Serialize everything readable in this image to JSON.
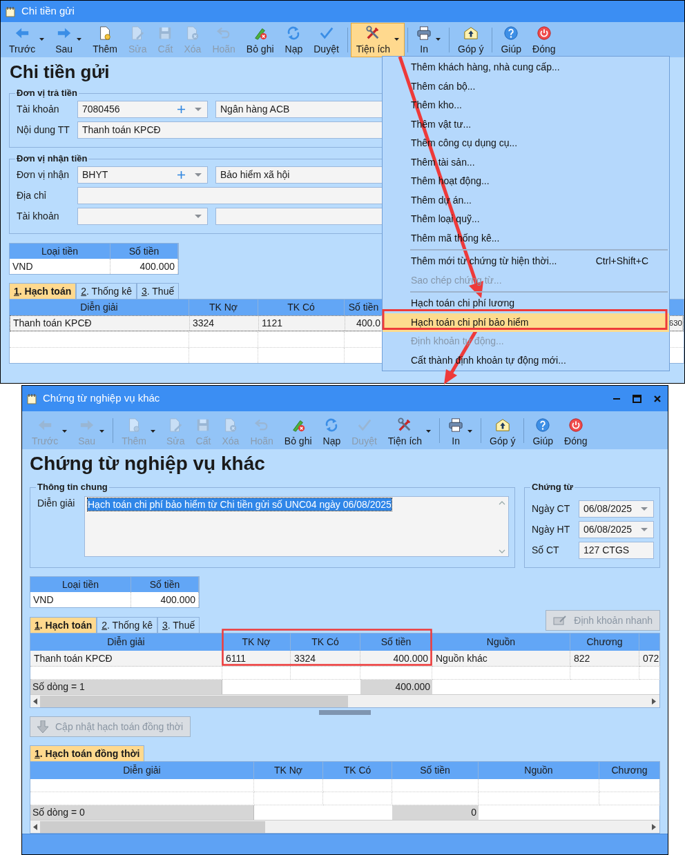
{
  "main_window": {
    "title": "Chi tiền gửi",
    "toolbar": [
      {
        "kind": "back",
        "label": "Trước",
        "disabled": false,
        "dropdown": true,
        "open": false
      },
      {
        "kind": "forward",
        "label": "Sau",
        "disabled": false,
        "dropdown": true,
        "open": false
      },
      {
        "kind": "new",
        "label": "Thêm",
        "disabled": false,
        "dropdown": false,
        "open": false
      },
      {
        "kind": "edit",
        "label": "Sửa",
        "disabled": true,
        "dropdown": false,
        "open": false
      },
      {
        "kind": "save",
        "label": "Cất",
        "disabled": true,
        "dropdown": false,
        "open": false
      },
      {
        "kind": "delete",
        "label": "Xóa",
        "disabled": true,
        "dropdown": false,
        "open": false
      },
      {
        "kind": "undo",
        "label": "Hoãn",
        "disabled": true,
        "dropdown": false,
        "open": false
      },
      {
        "kind": "unpost",
        "label": "Bỏ ghi",
        "disabled": false,
        "dropdown": false,
        "open": false
      },
      {
        "kind": "reload",
        "label": "Nạp",
        "disabled": false,
        "dropdown": false,
        "open": false
      },
      {
        "kind": "check",
        "label": "Duyệt",
        "disabled": false,
        "dropdown": false,
        "open": false
      },
      {
        "kind": "separator"
      },
      {
        "kind": "tools",
        "label": "Tiện ích",
        "disabled": false,
        "dropdown": true,
        "open": true
      },
      {
        "kind": "separator"
      },
      {
        "kind": "print",
        "label": "In",
        "disabled": false,
        "dropdown": true,
        "open": false
      },
      {
        "kind": "separator"
      },
      {
        "kind": "feedback",
        "label": "Góp ý",
        "disabled": false,
        "dropdown": false,
        "open": false
      },
      {
        "kind": "separator"
      },
      {
        "kind": "help",
        "label": "Giúp",
        "disabled": false,
        "dropdown": false,
        "open": false
      },
      {
        "kind": "power",
        "label": "Đóng",
        "disabled": false,
        "dropdown": false,
        "open": false
      }
    ],
    "heading": "Chi tiền gửi",
    "groups": [
      {
        "title": "Đơn vị trả tiền",
        "rows": [
          {
            "label": "Tài khoản",
            "kind": "combo_pair",
            "value": "7080456",
            "add_button": true,
            "detail": "Ngân hàng ACB"
          },
          {
            "label": "Nội dung TT",
            "kind": "text",
            "value": "Thanh toán KPCĐ"
          }
        ]
      },
      {
        "title": "Đơn vị nhận tiền",
        "rows": [
          {
            "label": "Đơn vị nhận",
            "kind": "combo_pair",
            "value": "BHYT",
            "add_button": true,
            "detail": "Bảo hiểm xã hội"
          },
          {
            "label": "Địa chỉ",
            "kind": "text"
          },
          {
            "label": "Tài khoản",
            "kind": "combo_pair",
            "add_button": false
          }
        ]
      }
    ],
    "currency": {
      "columns": [
        "Loại tiền",
        "Số tiền"
      ],
      "rows": [
        [
          "VND",
          "400.000"
        ]
      ]
    },
    "tabs": [
      {
        "label": "1. Hạch toán",
        "selected": true
      },
      {
        "label": "2. Thống kê",
        "selected": false
      },
      {
        "label": "3. Thuế",
        "selected": false
      }
    ],
    "grid": {
      "columns": [
        "Diễn giải",
        "TK Nợ",
        "TK Có",
        "Số tiền"
      ],
      "rows": [
        [
          "Thanh toán KPCĐ",
          "3324",
          "1121",
          "400.0",
          "630"
        ]
      ]
    }
  },
  "menu": {
    "items": [
      {
        "kind": "item",
        "label": "Thêm khách hàng, nhà cung cấp...",
        "disabled": false,
        "selected": false
      },
      {
        "kind": "item",
        "label": "Thêm cán bộ...",
        "disabled": false,
        "selected": false
      },
      {
        "kind": "item",
        "label": "Thêm kho...",
        "disabled": false,
        "selected": false
      },
      {
        "kind": "item",
        "label": "Thêm vật tư...",
        "disabled": false,
        "selected": false
      },
      {
        "kind": "item",
        "label": "Thêm công cụ dụng cụ...",
        "disabled": false,
        "selected": false
      },
      {
        "kind": "item",
        "label": "Thêm tài sản...",
        "disabled": false,
        "selected": false
      },
      {
        "kind": "item",
        "label": "Thêm hoạt động...",
        "disabled": false,
        "selected": false
      },
      {
        "kind": "item",
        "label": "Thêm dự án...",
        "disabled": false,
        "selected": false
      },
      {
        "kind": "item",
        "label": "Thêm loại quỹ...",
        "disabled": false,
        "selected": false
      },
      {
        "kind": "item",
        "label": "Thêm mã thống kê...",
        "disabled": false,
        "selected": false
      },
      {
        "kind": "separator"
      },
      {
        "kind": "item",
        "label": "Thêm mới từ chứng từ hiện thời...",
        "shortcut": "Ctrl+Shift+C",
        "disabled": false,
        "selected": false
      },
      {
        "kind": "item",
        "label": "Sao chép chứng từ...",
        "disabled": true,
        "selected": false
      },
      {
        "kind": "separator"
      },
      {
        "kind": "item",
        "label": "Hạch toán chi phí lương",
        "disabled": false,
        "selected": false
      },
      {
        "kind": "item",
        "label": "Hạch toán chi phí bảo hiểm",
        "disabled": false,
        "selected": true
      },
      {
        "kind": "item",
        "label": "Định khoản tự động...",
        "disabled": true,
        "selected": false
      },
      {
        "kind": "item",
        "label": "Cất thành định khoản tự động mới...",
        "disabled": false,
        "selected": false
      }
    ]
  },
  "document_window": {
    "title": "Chứng từ nghiệp vụ khác",
    "toolbar": [
      {
        "kind": "back",
        "label": "Trước",
        "disabled": true,
        "dropdown": true
      },
      {
        "kind": "forward",
        "label": "Sau",
        "disabled": true,
        "dropdown": true
      },
      {
        "kind": "separator"
      },
      {
        "kind": "new",
        "label": "Thêm",
        "disabled": true,
        "dropdown": true
      },
      {
        "kind": "edit",
        "label": "Sửa",
        "disabled": true,
        "dropdown": false
      },
      {
        "kind": "save",
        "label": "Cất",
        "disabled": true,
        "dropdown": false
      },
      {
        "kind": "delete",
        "label": "Xóa",
        "disabled": true,
        "dropdown": false
      },
      {
        "kind": "undo",
        "label": "Hoãn",
        "disabled": true,
        "dropdown": false
      },
      {
        "kind": "unpost",
        "label": "Bỏ ghi",
        "disabled": false,
        "dropdown": false
      },
      {
        "kind": "reload",
        "label": "Nạp",
        "disabled": false,
        "dropdown": false
      },
      {
        "kind": "check",
        "label": "Duyệt",
        "disabled": true,
        "dropdown": false
      },
      {
        "kind": "tools",
        "label": "Tiện ích",
        "disabled": false,
        "dropdown": true
      },
      {
        "kind": "separator"
      },
      {
        "kind": "print",
        "label": "In",
        "disabled": false,
        "dropdown": true
      },
      {
        "kind": "separator"
      },
      {
        "kind": "feedback",
        "label": "Góp ý",
        "disabled": false,
        "dropdown": false
      },
      {
        "kind": "separator"
      },
      {
        "kind": "help",
        "label": "Giúp",
        "disabled": false,
        "dropdown": false
      },
      {
        "kind": "power",
        "label": "Đóng",
        "disabled": false,
        "dropdown": false
      }
    ],
    "heading": "Chứng từ nghiệp vụ khác",
    "general": {
      "title": "Thông tin chung",
      "label": "Diễn giải",
      "value": "Hạch toán chi phí bảo hiểm từ Chi tiền gửi số UNC04 ngày 06/08/2025",
      "selected": true
    },
    "voucher": {
      "title": "Chứng từ",
      "fields": [
        {
          "label": "Ngày CT",
          "kind": "date",
          "value": "06/08/2025"
        },
        {
          "label": "Ngày HT",
          "kind": "date",
          "value": "06/08/2025"
        },
        {
          "label": "Số CT",
          "kind": "text",
          "value": "127 CTGS"
        }
      ]
    },
    "currency": {
      "columns": [
        "Loại tiền",
        "Số tiền"
      ],
      "rows": [
        [
          "VND",
          "400.000"
        ]
      ]
    },
    "quick_button": {
      "label": "Định khoản nhanh",
      "disabled": true
    },
    "tabs": [
      {
        "label": "1. Hạch toán",
        "selected": true
      },
      {
        "label": "2. Thống kê",
        "selected": false
      },
      {
        "label": "3. Thuế",
        "selected": false
      }
    ],
    "grid": {
      "columns": [
        "Diễn giải",
        "TK Nợ",
        "TK Có",
        "Số tiền",
        "Nguồn",
        "Chương"
      ],
      "rows": [
        [
          "Thanh toán KPCĐ",
          "6111",
          "3324",
          "400.000",
          "Nguồn khác",
          "822",
          "072"
        ]
      ],
      "footer": {
        "count": "Số dòng = 1",
        "total": "400.000"
      }
    },
    "update_button": {
      "label": "Cập nhật hạch toán đồng thời",
      "disabled": true
    },
    "concurrent_tabs": [
      {
        "label": "1. Hạch toán đồng thời",
        "selected": true
      }
    ],
    "concurrent_grid": {
      "columns": [
        "Diễn giải",
        "TK Nợ",
        "TK Có",
        "Số tiền",
        "Nguồn",
        "Chương"
      ],
      "footer": {
        "count": "Số dòng = 0",
        "total": "0"
      }
    }
  }
}
